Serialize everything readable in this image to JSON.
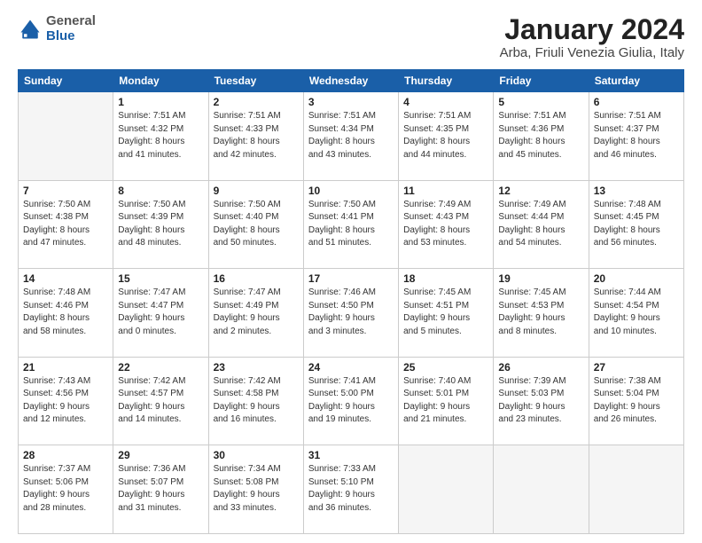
{
  "logo": {
    "general": "General",
    "blue": "Blue"
  },
  "title": "January 2024",
  "location": "Arba, Friuli Venezia Giulia, Italy",
  "days_header": [
    "Sunday",
    "Monday",
    "Tuesday",
    "Wednesday",
    "Thursday",
    "Friday",
    "Saturday"
  ],
  "weeks": [
    [
      {
        "day": "",
        "lines": []
      },
      {
        "day": "1",
        "lines": [
          "Sunrise: 7:51 AM",
          "Sunset: 4:32 PM",
          "Daylight: 8 hours",
          "and 41 minutes."
        ]
      },
      {
        "day": "2",
        "lines": [
          "Sunrise: 7:51 AM",
          "Sunset: 4:33 PM",
          "Daylight: 8 hours",
          "and 42 minutes."
        ]
      },
      {
        "day": "3",
        "lines": [
          "Sunrise: 7:51 AM",
          "Sunset: 4:34 PM",
          "Daylight: 8 hours",
          "and 43 minutes."
        ]
      },
      {
        "day": "4",
        "lines": [
          "Sunrise: 7:51 AM",
          "Sunset: 4:35 PM",
          "Daylight: 8 hours",
          "and 44 minutes."
        ]
      },
      {
        "day": "5",
        "lines": [
          "Sunrise: 7:51 AM",
          "Sunset: 4:36 PM",
          "Daylight: 8 hours",
          "and 45 minutes."
        ]
      },
      {
        "day": "6",
        "lines": [
          "Sunrise: 7:51 AM",
          "Sunset: 4:37 PM",
          "Daylight: 8 hours",
          "and 46 minutes."
        ]
      }
    ],
    [
      {
        "day": "7",
        "lines": [
          "Sunrise: 7:50 AM",
          "Sunset: 4:38 PM",
          "Daylight: 8 hours",
          "and 47 minutes."
        ]
      },
      {
        "day": "8",
        "lines": [
          "Sunrise: 7:50 AM",
          "Sunset: 4:39 PM",
          "Daylight: 8 hours",
          "and 48 minutes."
        ]
      },
      {
        "day": "9",
        "lines": [
          "Sunrise: 7:50 AM",
          "Sunset: 4:40 PM",
          "Daylight: 8 hours",
          "and 50 minutes."
        ]
      },
      {
        "day": "10",
        "lines": [
          "Sunrise: 7:50 AM",
          "Sunset: 4:41 PM",
          "Daylight: 8 hours",
          "and 51 minutes."
        ]
      },
      {
        "day": "11",
        "lines": [
          "Sunrise: 7:49 AM",
          "Sunset: 4:43 PM",
          "Daylight: 8 hours",
          "and 53 minutes."
        ]
      },
      {
        "day": "12",
        "lines": [
          "Sunrise: 7:49 AM",
          "Sunset: 4:44 PM",
          "Daylight: 8 hours",
          "and 54 minutes."
        ]
      },
      {
        "day": "13",
        "lines": [
          "Sunrise: 7:48 AM",
          "Sunset: 4:45 PM",
          "Daylight: 8 hours",
          "and 56 minutes."
        ]
      }
    ],
    [
      {
        "day": "14",
        "lines": [
          "Sunrise: 7:48 AM",
          "Sunset: 4:46 PM",
          "Daylight: 8 hours",
          "and 58 minutes."
        ]
      },
      {
        "day": "15",
        "lines": [
          "Sunrise: 7:47 AM",
          "Sunset: 4:47 PM",
          "Daylight: 9 hours",
          "and 0 minutes."
        ]
      },
      {
        "day": "16",
        "lines": [
          "Sunrise: 7:47 AM",
          "Sunset: 4:49 PM",
          "Daylight: 9 hours",
          "and 2 minutes."
        ]
      },
      {
        "day": "17",
        "lines": [
          "Sunrise: 7:46 AM",
          "Sunset: 4:50 PM",
          "Daylight: 9 hours",
          "and 3 minutes."
        ]
      },
      {
        "day": "18",
        "lines": [
          "Sunrise: 7:45 AM",
          "Sunset: 4:51 PM",
          "Daylight: 9 hours",
          "and 5 minutes."
        ]
      },
      {
        "day": "19",
        "lines": [
          "Sunrise: 7:45 AM",
          "Sunset: 4:53 PM",
          "Daylight: 9 hours",
          "and 8 minutes."
        ]
      },
      {
        "day": "20",
        "lines": [
          "Sunrise: 7:44 AM",
          "Sunset: 4:54 PM",
          "Daylight: 9 hours",
          "and 10 minutes."
        ]
      }
    ],
    [
      {
        "day": "21",
        "lines": [
          "Sunrise: 7:43 AM",
          "Sunset: 4:56 PM",
          "Daylight: 9 hours",
          "and 12 minutes."
        ]
      },
      {
        "day": "22",
        "lines": [
          "Sunrise: 7:42 AM",
          "Sunset: 4:57 PM",
          "Daylight: 9 hours",
          "and 14 minutes."
        ]
      },
      {
        "day": "23",
        "lines": [
          "Sunrise: 7:42 AM",
          "Sunset: 4:58 PM",
          "Daylight: 9 hours",
          "and 16 minutes."
        ]
      },
      {
        "day": "24",
        "lines": [
          "Sunrise: 7:41 AM",
          "Sunset: 5:00 PM",
          "Daylight: 9 hours",
          "and 19 minutes."
        ]
      },
      {
        "day": "25",
        "lines": [
          "Sunrise: 7:40 AM",
          "Sunset: 5:01 PM",
          "Daylight: 9 hours",
          "and 21 minutes."
        ]
      },
      {
        "day": "26",
        "lines": [
          "Sunrise: 7:39 AM",
          "Sunset: 5:03 PM",
          "Daylight: 9 hours",
          "and 23 minutes."
        ]
      },
      {
        "day": "27",
        "lines": [
          "Sunrise: 7:38 AM",
          "Sunset: 5:04 PM",
          "Daylight: 9 hours",
          "and 26 minutes."
        ]
      }
    ],
    [
      {
        "day": "28",
        "lines": [
          "Sunrise: 7:37 AM",
          "Sunset: 5:06 PM",
          "Daylight: 9 hours",
          "and 28 minutes."
        ]
      },
      {
        "day": "29",
        "lines": [
          "Sunrise: 7:36 AM",
          "Sunset: 5:07 PM",
          "Daylight: 9 hours",
          "and 31 minutes."
        ]
      },
      {
        "day": "30",
        "lines": [
          "Sunrise: 7:34 AM",
          "Sunset: 5:08 PM",
          "Daylight: 9 hours",
          "and 33 minutes."
        ]
      },
      {
        "day": "31",
        "lines": [
          "Sunrise: 7:33 AM",
          "Sunset: 5:10 PM",
          "Daylight: 9 hours",
          "and 36 minutes."
        ]
      },
      {
        "day": "",
        "lines": []
      },
      {
        "day": "",
        "lines": []
      },
      {
        "day": "",
        "lines": []
      }
    ]
  ]
}
